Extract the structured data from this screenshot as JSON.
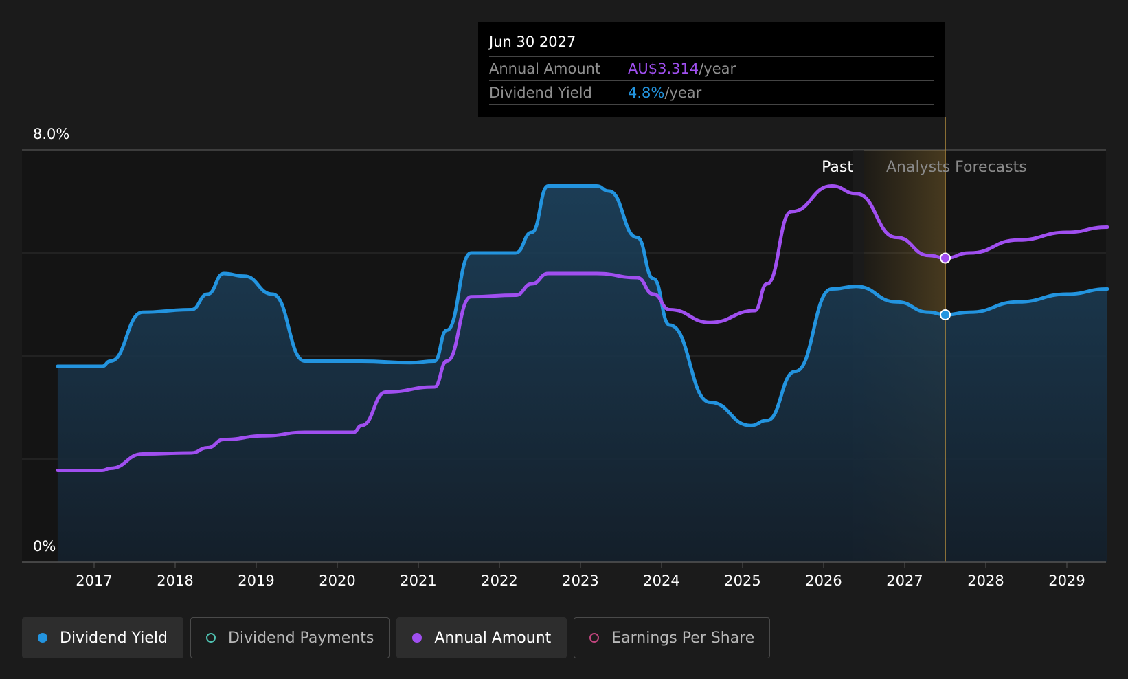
{
  "chart_data": {
    "type": "area",
    "title": "",
    "xlabel": "",
    "ylabel": "",
    "x_ticks": [
      "2017",
      "2018",
      "2019",
      "2020",
      "2021",
      "2022",
      "2023",
      "2024",
      "2025",
      "2026",
      "2027",
      "2028",
      "2029"
    ],
    "y_tick_labels": [
      "8.0%",
      "0%"
    ],
    "ylim": [
      0,
      8.0
    ],
    "xlim": [
      2016.0,
      2029.5
    ],
    "grid": true,
    "past_label": "Past",
    "forecast_label": "Analysts Forecasts",
    "past_forecast_boundary": 2026.5,
    "series": [
      {
        "name": "Dividend Yield",
        "unit": "%",
        "color": "#2394df",
        "filled": true,
        "x": [
          2016.55,
          2017.1,
          2017.2,
          2017.6,
          2018.2,
          2018.4,
          2018.6,
          2018.85,
          2019.2,
          2019.6,
          2020.3,
          2020.9,
          2021.2,
          2021.35,
          2021.65,
          2022.2,
          2022.4,
          2022.6,
          2023.2,
          2023.35,
          2023.7,
          2023.9,
          2024.1,
          2024.6,
          2025.1,
          2025.3,
          2025.65,
          2026.1,
          2026.4,
          2026.9,
          2027.3,
          2027.5,
          2027.8,
          2028.4,
          2029.0,
          2029.5
        ],
        "y": [
          3.8,
          3.8,
          3.9,
          4.85,
          4.9,
          5.2,
          5.6,
          5.55,
          5.2,
          3.9,
          3.9,
          3.87,
          3.9,
          4.5,
          6.0,
          6.0,
          6.4,
          7.3,
          7.3,
          7.2,
          6.3,
          5.5,
          4.6,
          3.1,
          2.65,
          2.75,
          3.7,
          5.3,
          5.35,
          5.05,
          4.85,
          4.8,
          4.85,
          5.05,
          5.2,
          5.3
        ]
      },
      {
        "name": "Annual Amount",
        "unit": "AU$",
        "color": "#a04ff0",
        "filled": false,
        "x": [
          2016.55,
          2017.1,
          2017.2,
          2017.6,
          2018.2,
          2018.4,
          2018.6,
          2019.1,
          2019.6,
          2020.2,
          2020.3,
          2020.6,
          2021.2,
          2021.35,
          2021.65,
          2022.2,
          2022.4,
          2022.6,
          2023.2,
          2023.7,
          2023.9,
          2024.1,
          2024.6,
          2025.15,
          2025.3,
          2025.6,
          2026.1,
          2026.4,
          2026.9,
          2027.3,
          2027.5,
          2027.8,
          2028.4,
          2029.0,
          2029.5
        ],
        "y": [
          1.78,
          1.78,
          1.82,
          2.1,
          2.12,
          2.22,
          2.38,
          2.45,
          2.52,
          2.52,
          2.65,
          3.3,
          3.4,
          3.9,
          5.15,
          5.18,
          5.4,
          5.6,
          5.6,
          5.52,
          5.2,
          4.9,
          4.65,
          4.88,
          5.4,
          6.8,
          7.3,
          7.15,
          6.3,
          5.95,
          5.9,
          6.0,
          6.25,
          6.4,
          6.5
        ]
      }
    ]
  },
  "tooltip": {
    "date": "Jun 30 2027",
    "x": 2027.5,
    "rows": [
      {
        "label": "Annual Amount",
        "value": "AU$3.314",
        "unit": "/year",
        "color": "#a04ff0"
      },
      {
        "label": "Dividend Yield",
        "value": "4.8%",
        "unit": "/year",
        "color": "#2394df"
      }
    ]
  },
  "legend": [
    {
      "label": "Dividend Yield",
      "color": "#2394df",
      "style": "filled",
      "active": true
    },
    {
      "label": "Dividend Payments",
      "color": "#4fc1b0",
      "style": "hollow",
      "active": false
    },
    {
      "label": "Annual Amount",
      "color": "#a04ff0",
      "style": "filled",
      "active": true
    },
    {
      "label": "Earnings Per Share",
      "color": "#c2457e",
      "style": "hollow",
      "active": false
    }
  ]
}
